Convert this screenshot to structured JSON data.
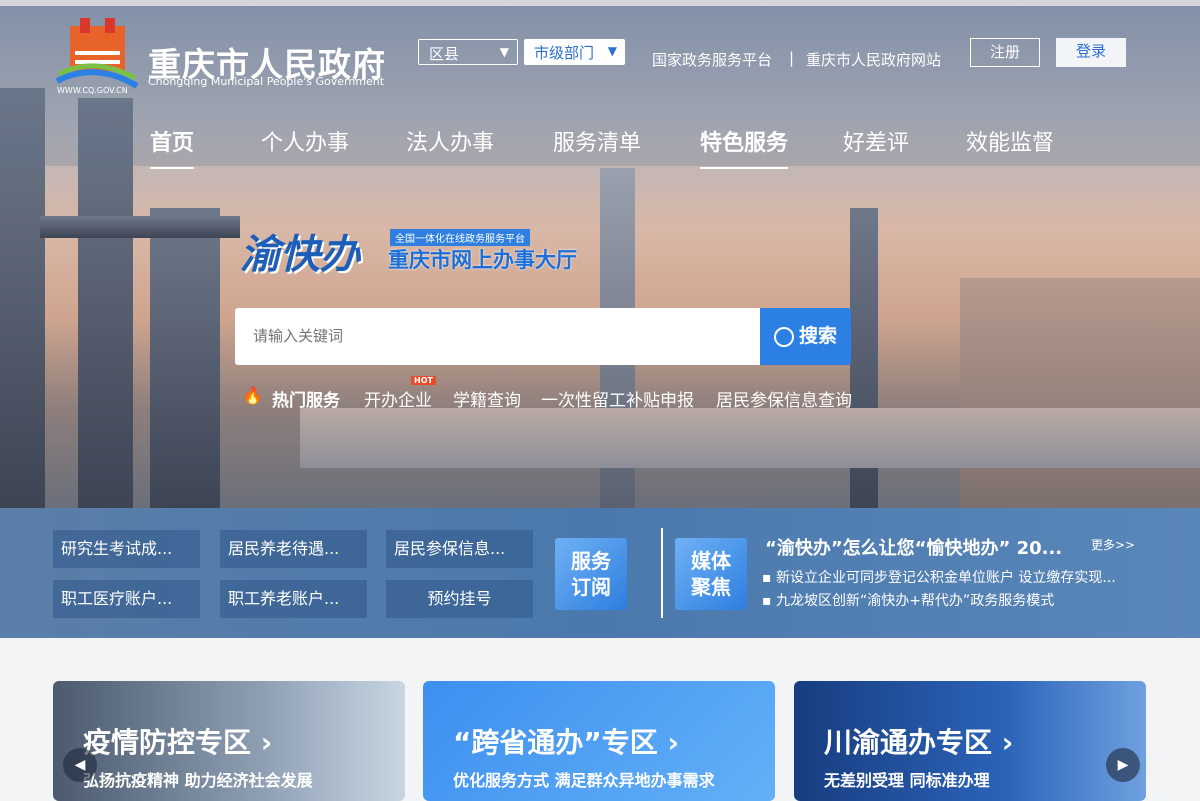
{
  "header": {
    "title": "重庆市人民政府",
    "subtitle": "Chongqing Municipal People's Government",
    "url": "WWW.CQ.GOV.CN",
    "select_district": "区县",
    "select_dept": "市级部门",
    "links": [
      "国家政务服务平台",
      "|",
      "重庆市人民政府网站"
    ],
    "register": "注册",
    "login": "登录"
  },
  "nav": [
    "首页",
    "个人办事",
    "法人办事",
    "服务清单",
    "特色服务",
    "好差评",
    "效能监督"
  ],
  "hero": {
    "brand": "渝快办",
    "tag": "全国一体化在线政务服务平台",
    "title": "重庆市网上办事大厅",
    "search_placeholder": "请输入关键词",
    "search_button": "搜索",
    "hot_label": "热门服务",
    "hot_badge": "HOT",
    "hot_items": [
      "开办企业",
      "学籍查询",
      "一次性留工补贴申报",
      "居民参保信息查询"
    ]
  },
  "quick": [
    "研究生考试成...",
    "居民养老待遇...",
    "居民参保信息...",
    "职工医疗账户...",
    "职工养老账户...",
    "预约挂号"
  ],
  "service_sub": [
    "服务",
    "订阅"
  ],
  "media": {
    "badge": [
      "媒体",
      "聚焦"
    ],
    "headline": "“渝快办”怎么让您“愉快地办” 20...",
    "more": "更多>>",
    "items": [
      "新设立企业可同步登记公积金单位账户 设立缴存实现...",
      "九龙坡区创新“渝快办+帮代办”政务服务模式"
    ]
  },
  "cards": [
    {
      "title": "疫情防控专区",
      "sub": "弘扬抗疫精神  助力经济社会发展"
    },
    {
      "title": "“跨省通办”专区",
      "sub": "优化服务方式  满足群众异地办事需求"
    },
    {
      "title": "川渝通办专区",
      "sub": "无差别受理  同标准办理"
    }
  ],
  "colors": {
    "accent": "#2d80e3",
    "band": "#4b79ad"
  }
}
